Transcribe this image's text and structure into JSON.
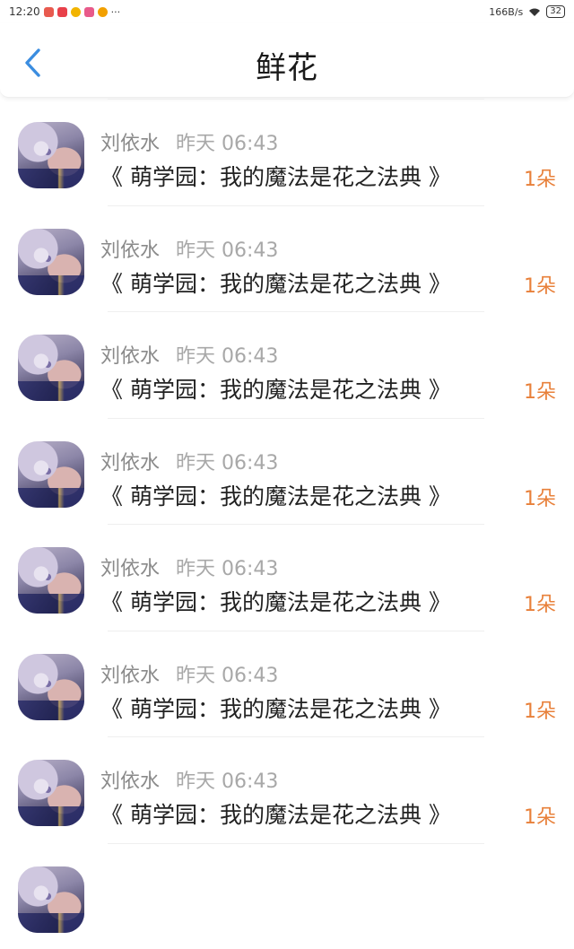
{
  "status_bar": {
    "time": "12:20",
    "more": "···",
    "net_speed": "166B/s",
    "battery": "32",
    "notif_colors": [
      "#e85a4f",
      "#e8404a",
      "#f2b400",
      "#e85a8a",
      "#f2a000"
    ]
  },
  "header": {
    "title": "鲜花",
    "back_icon": "chevron-left-icon",
    "accent": "#3b8de0"
  },
  "items": [
    {
      "user": "刘依水",
      "time": "昨天 06:43",
      "book": "《 萌学园：我的魔法是花之法典 》",
      "count": "1朵"
    },
    {
      "user": "刘依水",
      "time": "昨天 06:43",
      "book": "《 萌学园：我的魔法是花之法典 》",
      "count": "1朵"
    },
    {
      "user": "刘依水",
      "time": "昨天 06:43",
      "book": "《 萌学园：我的魔法是花之法典 》",
      "count": "1朵"
    },
    {
      "user": "刘依水",
      "time": "昨天 06:43",
      "book": "《 萌学园：我的魔法是花之法典 》",
      "count": "1朵"
    },
    {
      "user": "刘依水",
      "time": "昨天 06:43",
      "book": "《 萌学园：我的魔法是花之法典 》",
      "count": "1朵"
    },
    {
      "user": "刘依水",
      "time": "昨天 06:43",
      "book": "《 萌学园：我的魔法是花之法典 》",
      "count": "1朵"
    },
    {
      "user": "刘依水",
      "time": "昨天 06:43",
      "book": "《 萌学园：我的魔法是花之法典 》",
      "count": "1朵"
    },
    {
      "user": "",
      "time": "",
      "book": "",
      "count": ""
    }
  ]
}
